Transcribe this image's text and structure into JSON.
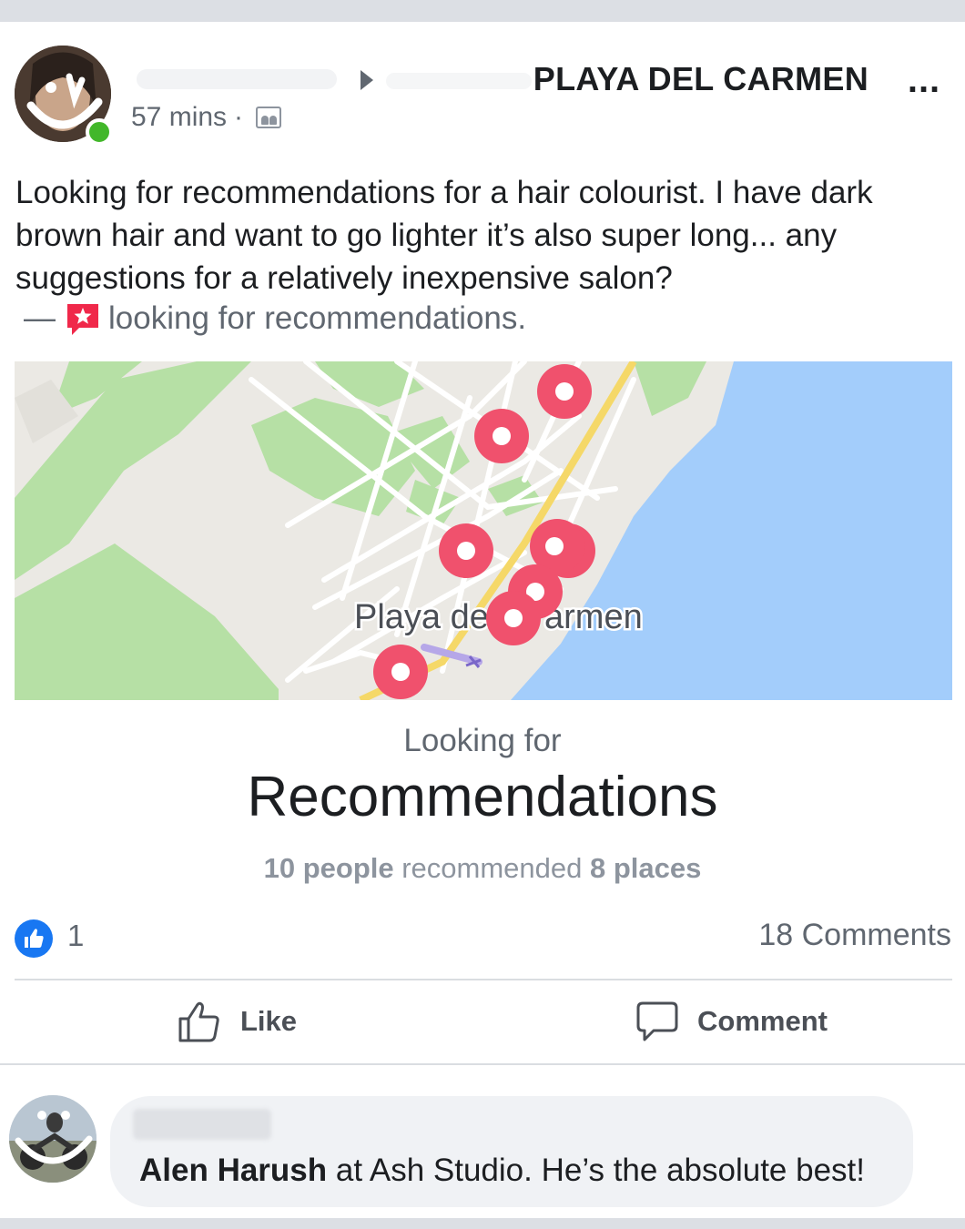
{
  "post": {
    "group_name": "PLAYA DEL CARMEN",
    "time": "57 mins",
    "separator": "·",
    "more_label": "...",
    "text": "Looking for recommendations for a hair colourist. I have dark brown hair and want to go lighter it’s also super long... any suggestions for a relatively inexpensive salon?",
    "dash": "—",
    "badge_text": "looking for recommendations."
  },
  "map": {
    "city_label_left": "Playa de",
    "city_label_right": "armen",
    "pin_color": "#f0516d",
    "water_color": "#a3cdfb",
    "park_color": "#b6e0a5"
  },
  "recommendations": {
    "subtitle": "Looking for",
    "title": "Recommendations",
    "people": "10 people",
    "middle": "recommended",
    "places": "8 places"
  },
  "stats": {
    "likes": "1",
    "comments": "18 Comments"
  },
  "actions": {
    "like_label": "Like",
    "comment_label": "Comment"
  },
  "comment": {
    "bold": "Alen Harush",
    "text": " at Ash Studio. He’s the absolute best!"
  },
  "colors": {
    "accent": "#1877f2",
    "online": "#42b72a",
    "badge": "#f0284a"
  }
}
